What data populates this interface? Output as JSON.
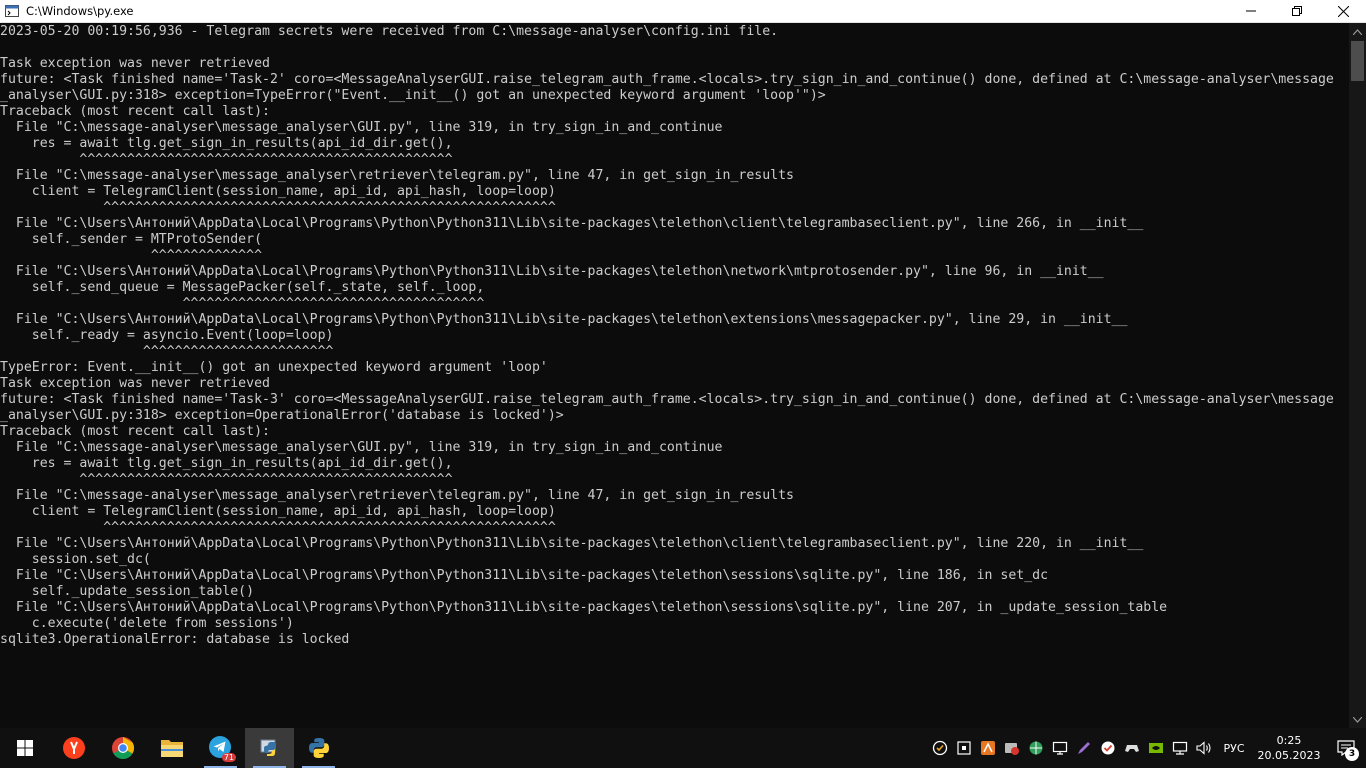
{
  "window": {
    "title": "C:\\Windows\\py.exe"
  },
  "console": {
    "lines": [
      "2023-05-20 00:19:56,936 - Telegram secrets were received from C:\\message-analyser\\config.ini file.",
      "",
      "Task exception was never retrieved",
      "future: <Task finished name='Task-2' coro=<MessageAnalyserGUI.raise_telegram_auth_frame.<locals>.try_sign_in_and_continue() done, defined at C:\\message-analyser\\message",
      "_analyser\\GUI.py:318> exception=TypeError(\"Event.__init__() got an unexpected keyword argument 'loop'\")>",
      "Traceback (most recent call last):",
      "  File \"C:\\message-analyser\\message_analyser\\GUI.py\", line 319, in try_sign_in_and_continue",
      "    res = await tlg.get_sign_in_results(api_id_dir.get(),",
      "          ^^^^^^^^^^^^^^^^^^^^^^^^^^^^^^^^^^^^^^^^^^^^^^^",
      "  File \"C:\\message-analyser\\message_analyser\\retriever\\telegram.py\", line 47, in get_sign_in_results",
      "    client = TelegramClient(session_name, api_id, api_hash, loop=loop)",
      "             ^^^^^^^^^^^^^^^^^^^^^^^^^^^^^^^^^^^^^^^^^^^^^^^^^^^^^^^^^",
      "  File \"C:\\Users\\Антоний\\AppData\\Local\\Programs\\Python\\Python311\\Lib\\site-packages\\telethon\\client\\telegrambaseclient.py\", line 266, in __init__",
      "    self._sender = MTProtoSender(",
      "                   ^^^^^^^^^^^^^^",
      "  File \"C:\\Users\\Антоний\\AppData\\Local\\Programs\\Python\\Python311\\Lib\\site-packages\\telethon\\network\\mtprotosender.py\", line 96, in __init__",
      "    self._send_queue = MessagePacker(self._state, self._loop,",
      "                       ^^^^^^^^^^^^^^^^^^^^^^^^^^^^^^^^^^^^^^",
      "  File \"C:\\Users\\Антоний\\AppData\\Local\\Programs\\Python\\Python311\\Lib\\site-packages\\telethon\\extensions\\messagepacker.py\", line 29, in __init__",
      "    self._ready = asyncio.Event(loop=loop)",
      "                  ^^^^^^^^^^^^^^^^^^^^^^^^",
      "TypeError: Event.__init__() got an unexpected keyword argument 'loop'",
      "Task exception was never retrieved",
      "future: <Task finished name='Task-3' coro=<MessageAnalyserGUI.raise_telegram_auth_frame.<locals>.try_sign_in_and_continue() done, defined at C:\\message-analyser\\message",
      "_analyser\\GUI.py:318> exception=OperationalError('database is locked')>",
      "Traceback (most recent call last):",
      "  File \"C:\\message-analyser\\message_analyser\\GUI.py\", line 319, in try_sign_in_and_continue",
      "    res = await tlg.get_sign_in_results(api_id_dir.get(),",
      "          ^^^^^^^^^^^^^^^^^^^^^^^^^^^^^^^^^^^^^^^^^^^^^^^",
      "  File \"C:\\message-analyser\\message_analyser\\retriever\\telegram.py\", line 47, in get_sign_in_results",
      "    client = TelegramClient(session_name, api_id, api_hash, loop=loop)",
      "             ^^^^^^^^^^^^^^^^^^^^^^^^^^^^^^^^^^^^^^^^^^^^^^^^^^^^^^^^^",
      "  File \"C:\\Users\\Антоний\\AppData\\Local\\Programs\\Python\\Python311\\Lib\\site-packages\\telethon\\client\\telegrambaseclient.py\", line 220, in __init__",
      "    session.set_dc(",
      "  File \"C:\\Users\\Антоний\\AppData\\Local\\Programs\\Python\\Python311\\Lib\\site-packages\\telethon\\sessions\\sqlite.py\", line 186, in set_dc",
      "    self._update_session_table()",
      "  File \"C:\\Users\\Антоний\\AppData\\Local\\Programs\\Python\\Python311\\Lib\\site-packages\\telethon\\sessions\\sqlite.py\", line 207, in _update_session_table",
      "    c.execute('delete from sessions')",
      "sqlite3.OperationalError: database is locked"
    ]
  },
  "taskbar": {
    "telegram_badge": "71",
    "language": "РУС",
    "time": "0:25",
    "date": "20.05.2023",
    "notification_count": "3"
  },
  "colors": {
    "console_bg": "#0c0c0c",
    "console_text": "#cccccc",
    "taskbar_bg": "#101010"
  }
}
